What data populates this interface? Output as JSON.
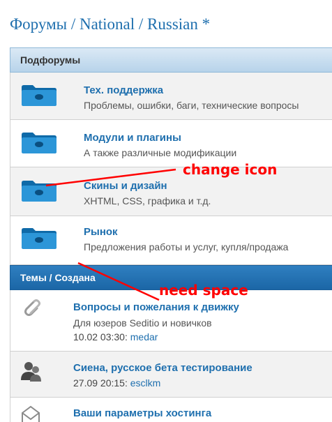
{
  "breadcrumb": "Форумы / National / Russian *",
  "subforums_header": "Подфорумы",
  "subforums": [
    {
      "title": "Тех. поддержка",
      "desc": "Проблемы, ошибки, баги, технические вопросы"
    },
    {
      "title": "Модули и плагины",
      "desc": "А также различные модификации"
    },
    {
      "title": "Скины и дизайн",
      "desc": "XHTML, CSS, графика и т.д."
    },
    {
      "title": "Рынок",
      "desc": "Предложения работы и услуг, купля/продажа"
    }
  ],
  "topics_header": "Темы / Создана",
  "topics": [
    {
      "title": "Вопросы и пожелания к движку",
      "desc": "Для юзеров Seditio и новичков",
      "date": "10.02 03:30:",
      "author": "medar",
      "icon": "paperclip-icon"
    },
    {
      "title": "Сиена, русское бета тестирование",
      "desc": "",
      "date": "27.09 20:15:",
      "author": "esclkm",
      "icon": "users-icon"
    },
    {
      "title": "Ваши параметры хостинга",
      "desc": "",
      "date": "",
      "author": "",
      "icon": "envelope-icon"
    }
  ],
  "annotations": {
    "change_icon": "change icon",
    "need_space": "need space"
  },
  "colors": {
    "link": "#1e6fae",
    "annotation": "#ff0000",
    "folder": "#1d86c9"
  }
}
